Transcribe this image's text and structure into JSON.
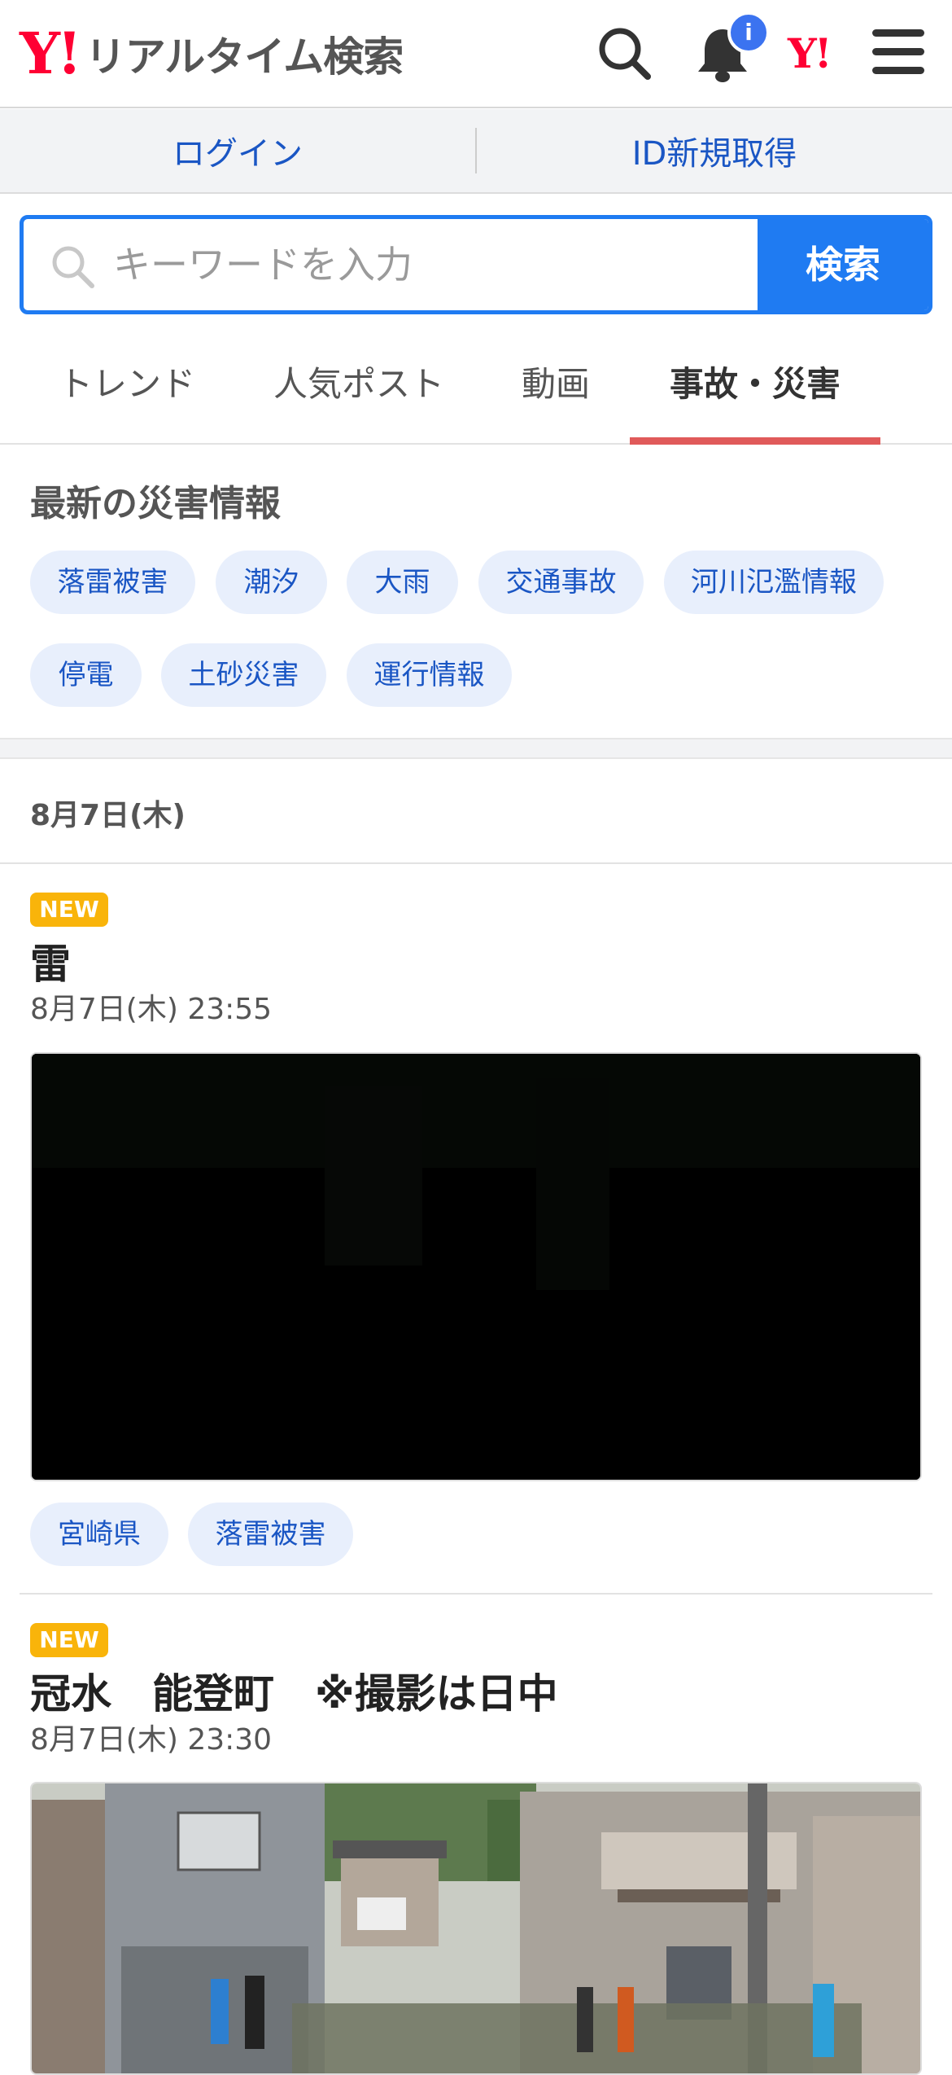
{
  "header": {
    "logo_mark": "Y!",
    "logo_text": "リアルタイム検索",
    "notification_badge": "i",
    "yj_mark": "Y!"
  },
  "login_bar": {
    "login": "ログイン",
    "register": "ID新規取得"
  },
  "search": {
    "placeholder": "キーワードを入力",
    "button": "検索"
  },
  "tabs": [
    {
      "label": "トレンド"
    },
    {
      "label": "人気ポスト"
    },
    {
      "label": "動画"
    },
    {
      "label": "事故・災害",
      "active": true
    }
  ],
  "disaster_section": {
    "title": "最新の災害情報",
    "chips": [
      "落雷被害",
      "潮汐",
      "大雨",
      "交通事故",
      "河川氾濫情報",
      "停電",
      "土砂災害",
      "運行情報"
    ]
  },
  "feed": {
    "date_header": "8月7日(木)",
    "posts": [
      {
        "badge": "NEW",
        "title": "雷",
        "time": "8月7日(木) 23:55",
        "media": "video",
        "tags": [
          "宮崎県",
          "落雷被害"
        ]
      },
      {
        "badge": "NEW",
        "title": "冠水　能登町　※撮影は日中",
        "time": "8月7日(木) 23:30",
        "media": "photo"
      }
    ]
  },
  "colors": {
    "accent_blue": "#1f7bf2",
    "brand_red": "#ff0033",
    "tab_underline": "#e05a5a",
    "new_badge": "#f9b40a",
    "chip_bg": "#e8effc"
  }
}
